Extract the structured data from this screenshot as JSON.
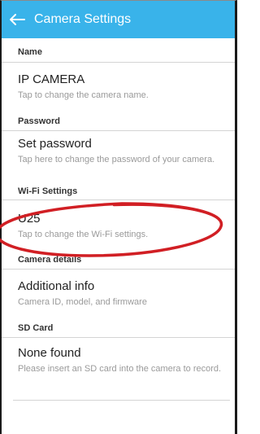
{
  "appbar": {
    "title": "Camera Settings",
    "back_icon": "back-arrow-icon"
  },
  "sections": {
    "name": {
      "header": "Name",
      "item_title": "IP CAMERA",
      "item_sub": "Tap to change the camera name."
    },
    "password": {
      "header": "Password",
      "item_title": "Set password",
      "item_sub": "Tap here to change the password of your camera."
    },
    "wifi": {
      "header": "Wi-Fi Settings",
      "item_title": "U25",
      "item_sub": "Tap to change the Wi-Fi settings."
    },
    "camera_details": {
      "header": "Camera details",
      "item_title": "Additional info",
      "item_sub": "Camera ID, model, and firmware"
    },
    "sd_card": {
      "header": "SD Card",
      "item_title": "None found",
      "item_sub": "Please insert an SD card into the camera to record."
    }
  },
  "colors": {
    "appbar": "#39b3ea",
    "annotation": "#d11f24"
  }
}
